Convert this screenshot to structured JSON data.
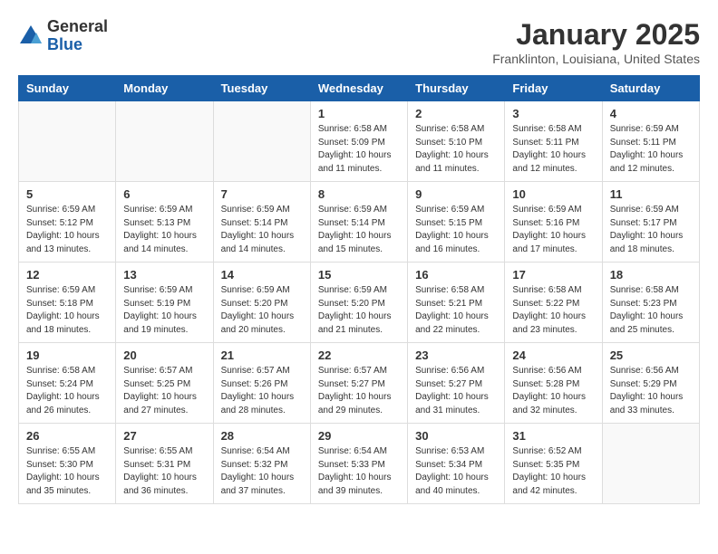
{
  "header": {
    "logo": {
      "line1": "General",
      "line2": "Blue"
    },
    "title": "January 2025",
    "location": "Franklinton, Louisiana, United States"
  },
  "columns": [
    "Sunday",
    "Monday",
    "Tuesday",
    "Wednesday",
    "Thursday",
    "Friday",
    "Saturday"
  ],
  "weeks": [
    [
      {
        "day": "",
        "empty": true
      },
      {
        "day": "",
        "empty": true
      },
      {
        "day": "",
        "empty": true
      },
      {
        "day": "1",
        "sunrise": "6:58 AM",
        "sunset": "5:09 PM",
        "daylight": "10 hours and 11 minutes."
      },
      {
        "day": "2",
        "sunrise": "6:58 AM",
        "sunset": "5:10 PM",
        "daylight": "10 hours and 11 minutes."
      },
      {
        "day": "3",
        "sunrise": "6:58 AM",
        "sunset": "5:11 PM",
        "daylight": "10 hours and 12 minutes."
      },
      {
        "day": "4",
        "sunrise": "6:59 AM",
        "sunset": "5:11 PM",
        "daylight": "10 hours and 12 minutes."
      }
    ],
    [
      {
        "day": "5",
        "sunrise": "6:59 AM",
        "sunset": "5:12 PM",
        "daylight": "10 hours and 13 minutes."
      },
      {
        "day": "6",
        "sunrise": "6:59 AM",
        "sunset": "5:13 PM",
        "daylight": "10 hours and 14 minutes."
      },
      {
        "day": "7",
        "sunrise": "6:59 AM",
        "sunset": "5:14 PM",
        "daylight": "10 hours and 14 minutes."
      },
      {
        "day": "8",
        "sunrise": "6:59 AM",
        "sunset": "5:14 PM",
        "daylight": "10 hours and 15 minutes."
      },
      {
        "day": "9",
        "sunrise": "6:59 AM",
        "sunset": "5:15 PM",
        "daylight": "10 hours and 16 minutes."
      },
      {
        "day": "10",
        "sunrise": "6:59 AM",
        "sunset": "5:16 PM",
        "daylight": "10 hours and 17 minutes."
      },
      {
        "day": "11",
        "sunrise": "6:59 AM",
        "sunset": "5:17 PM",
        "daylight": "10 hours and 18 minutes."
      }
    ],
    [
      {
        "day": "12",
        "sunrise": "6:59 AM",
        "sunset": "5:18 PM",
        "daylight": "10 hours and 18 minutes."
      },
      {
        "day": "13",
        "sunrise": "6:59 AM",
        "sunset": "5:19 PM",
        "daylight": "10 hours and 19 minutes."
      },
      {
        "day": "14",
        "sunrise": "6:59 AM",
        "sunset": "5:20 PM",
        "daylight": "10 hours and 20 minutes."
      },
      {
        "day": "15",
        "sunrise": "6:59 AM",
        "sunset": "5:20 PM",
        "daylight": "10 hours and 21 minutes."
      },
      {
        "day": "16",
        "sunrise": "6:58 AM",
        "sunset": "5:21 PM",
        "daylight": "10 hours and 22 minutes."
      },
      {
        "day": "17",
        "sunrise": "6:58 AM",
        "sunset": "5:22 PM",
        "daylight": "10 hours and 23 minutes."
      },
      {
        "day": "18",
        "sunrise": "6:58 AM",
        "sunset": "5:23 PM",
        "daylight": "10 hours and 25 minutes."
      }
    ],
    [
      {
        "day": "19",
        "sunrise": "6:58 AM",
        "sunset": "5:24 PM",
        "daylight": "10 hours and 26 minutes."
      },
      {
        "day": "20",
        "sunrise": "6:57 AM",
        "sunset": "5:25 PM",
        "daylight": "10 hours and 27 minutes."
      },
      {
        "day": "21",
        "sunrise": "6:57 AM",
        "sunset": "5:26 PM",
        "daylight": "10 hours and 28 minutes."
      },
      {
        "day": "22",
        "sunrise": "6:57 AM",
        "sunset": "5:27 PM",
        "daylight": "10 hours and 29 minutes."
      },
      {
        "day": "23",
        "sunrise": "6:56 AM",
        "sunset": "5:27 PM",
        "daylight": "10 hours and 31 minutes."
      },
      {
        "day": "24",
        "sunrise": "6:56 AM",
        "sunset": "5:28 PM",
        "daylight": "10 hours and 32 minutes."
      },
      {
        "day": "25",
        "sunrise": "6:56 AM",
        "sunset": "5:29 PM",
        "daylight": "10 hours and 33 minutes."
      }
    ],
    [
      {
        "day": "26",
        "sunrise": "6:55 AM",
        "sunset": "5:30 PM",
        "daylight": "10 hours and 35 minutes."
      },
      {
        "day": "27",
        "sunrise": "6:55 AM",
        "sunset": "5:31 PM",
        "daylight": "10 hours and 36 minutes."
      },
      {
        "day": "28",
        "sunrise": "6:54 AM",
        "sunset": "5:32 PM",
        "daylight": "10 hours and 37 minutes."
      },
      {
        "day": "29",
        "sunrise": "6:54 AM",
        "sunset": "5:33 PM",
        "daylight": "10 hours and 39 minutes."
      },
      {
        "day": "30",
        "sunrise": "6:53 AM",
        "sunset": "5:34 PM",
        "daylight": "10 hours and 40 minutes."
      },
      {
        "day": "31",
        "sunrise": "6:52 AM",
        "sunset": "5:35 PM",
        "daylight": "10 hours and 42 minutes."
      },
      {
        "day": "",
        "empty": true
      }
    ]
  ]
}
